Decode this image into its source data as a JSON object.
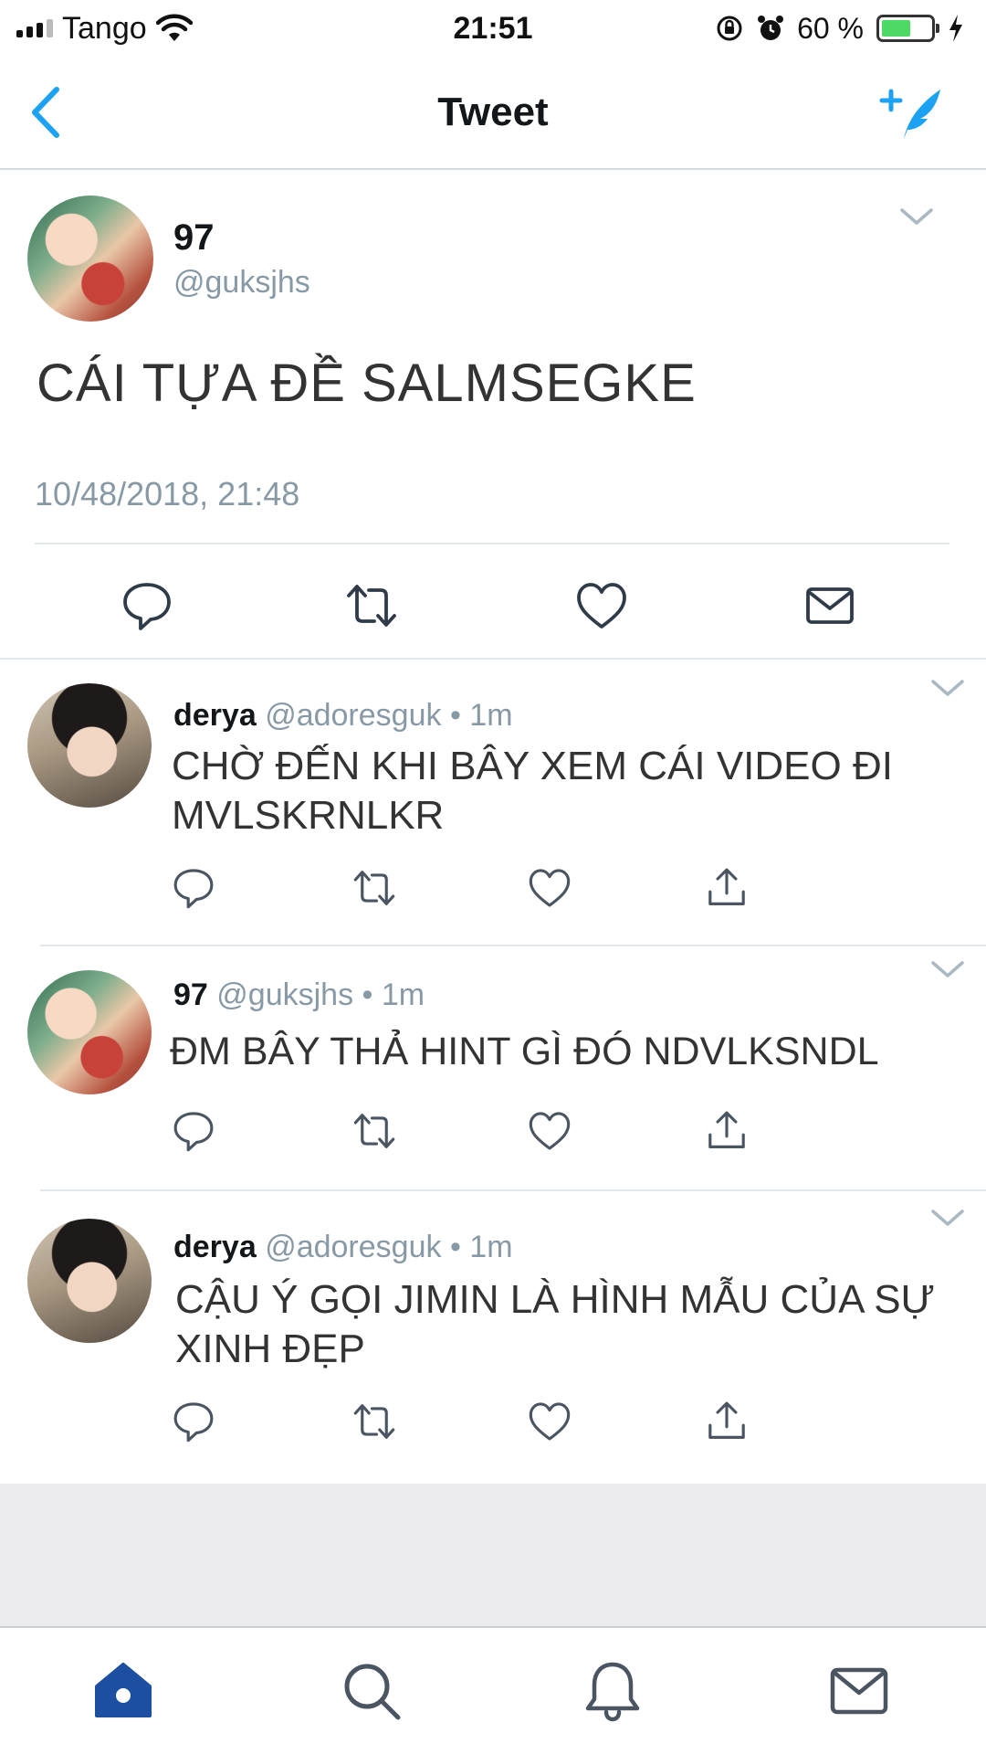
{
  "status_bar": {
    "carrier": "Tango",
    "time": "21:51",
    "battery_percent": "60 %",
    "battery_level": 0.6
  },
  "nav": {
    "title": "Tweet",
    "back_icon": "chevron-left-icon",
    "compose_icon": "compose-tweet-icon",
    "accent_color": "#1da1f2"
  },
  "main_tweet": {
    "name": "97",
    "handle": "@guksjhs",
    "text": "CÁI TỰA ĐỀ SALMSEGKE",
    "timestamp": "10/48/2018, 21:48",
    "actions": [
      "reply-icon",
      "retweet-icon",
      "like-icon",
      "message-icon"
    ]
  },
  "replies": [
    {
      "name": "derya",
      "handle": "@adoresguk",
      "dot": "•",
      "age": "1m",
      "text": "CHỜ ĐẾN KHI BÂY XEM CÁI VIDEO ĐI MVLSKRNLKR"
    },
    {
      "name": "97",
      "handle": "@guksjhs",
      "dot": "•",
      "age": "1m",
      "text": "ĐM BÂY THẢ HINT GÌ ĐÓ NDVLKSNDL"
    },
    {
      "name": "derya",
      "handle": "@adoresguk",
      "dot": "•",
      "age": "1m",
      "text": "CẬU Ý GỌI JIMIN LÀ HÌNH MẪU CỦA SỰ XINH ĐẸP"
    }
  ],
  "tab_bar": {
    "tabs": [
      "home-icon",
      "search-icon",
      "notifications-icon",
      "messages-icon"
    ],
    "active_color": "#1d4fa1"
  }
}
